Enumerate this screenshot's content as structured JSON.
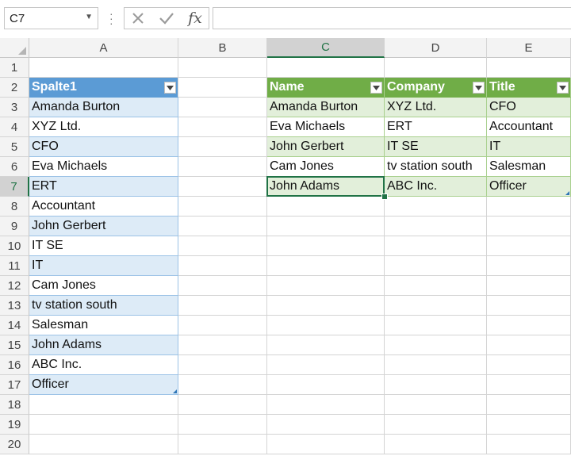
{
  "formula_bar": {
    "name_box": "C7",
    "formula": "",
    "cancel_icon": "close-icon",
    "enter_icon": "check-icon",
    "function_label": "fx"
  },
  "columns": [
    "A",
    "B",
    "C",
    "D",
    "E"
  ],
  "selected_column": "C",
  "rows": [
    "1",
    "2",
    "3",
    "4",
    "5",
    "6",
    "7",
    "8",
    "9",
    "10",
    "11",
    "12",
    "13",
    "14",
    "15",
    "16",
    "17",
    "18",
    "19",
    "20"
  ],
  "selected_row": "7",
  "table1": {
    "header": "Spalte1",
    "values": [
      "Amanda Burton",
      "XYZ Ltd.",
      "CFO",
      "Eva Michaels",
      "ERT",
      "Accountant",
      "John Gerbert",
      "IT SE",
      "IT",
      "Cam Jones",
      "tv station south",
      "Salesman",
      "John Adams",
      "ABC Inc.",
      "Officer"
    ]
  },
  "table2": {
    "headers": [
      "Name",
      "Company",
      "Title"
    ],
    "rows": [
      [
        "Amanda Burton",
        "XYZ Ltd.",
        "CFO"
      ],
      [
        "Eva Michaels",
        "ERT",
        "Accountant"
      ],
      [
        "John Gerbert",
        "IT SE",
        "IT"
      ],
      [
        "Cam Jones",
        "tv station south",
        "Salesman"
      ],
      [
        "John Adams",
        "ABC Inc.",
        "Officer"
      ]
    ]
  },
  "colors": {
    "table1_header": "#5b9bd5",
    "table2_header": "#70ad47",
    "selection": "#217346"
  }
}
